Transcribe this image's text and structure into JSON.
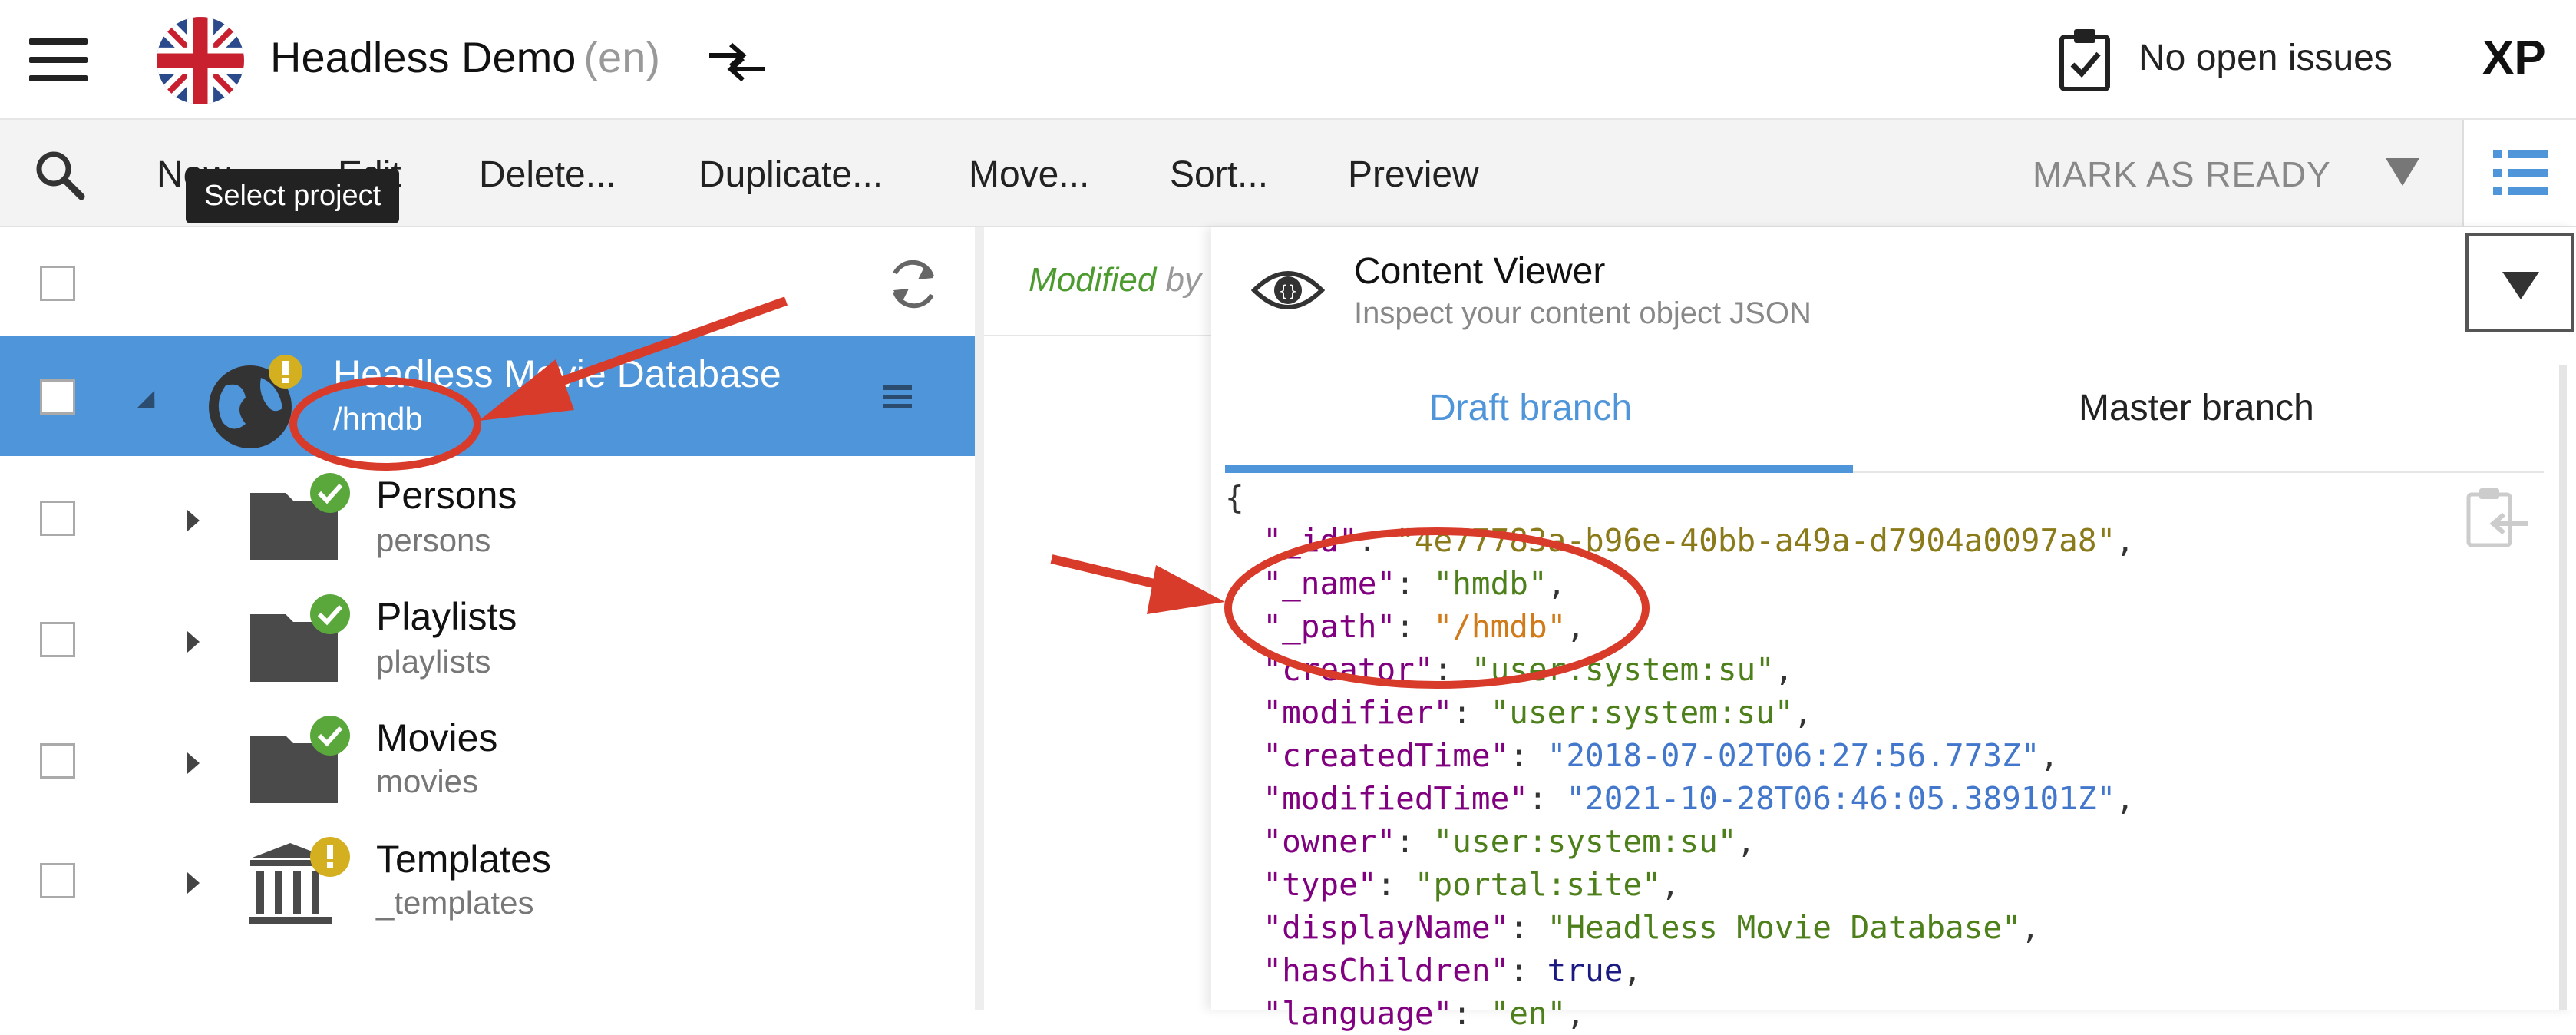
{
  "header": {
    "project_name": "Headless Demo",
    "project_lang": "(en)",
    "issues_label": "No open issues",
    "app_badge": "XP"
  },
  "toolbar": {
    "new_label": "New...",
    "edit_label": "Edit",
    "delete_label": "Delete...",
    "duplicate_label": "Duplicate...",
    "move_label": "Move...",
    "sort_label": "Sort...",
    "preview_label": "Preview",
    "mark_ready_label": "MARK AS READY",
    "tooltip": "Select project"
  },
  "tree": {
    "items": [
      {
        "name": "Headless Movie Database",
        "path": "/hmdb",
        "status": "warning"
      },
      {
        "name": "Persons",
        "path": "persons",
        "status": "ok"
      },
      {
        "name": "Playlists",
        "path": "playlists",
        "status": "ok"
      },
      {
        "name": "Movies",
        "path": "movies",
        "status": "ok"
      },
      {
        "name": "Templates",
        "path": "_templates",
        "status": "warning"
      }
    ]
  },
  "middle": {
    "modified_label": "Modified",
    "by_label": "by"
  },
  "panel": {
    "title": "Content Viewer",
    "subtitle": "Inspect your content object JSON",
    "tabs": [
      "Draft branch",
      "Master branch"
    ],
    "json_lines": [
      {
        "key": "_id",
        "val": "\"4e77783a-b96e-40bb-a49a-d7904a0097a8\"",
        "cls": "s-olive",
        "trail": ","
      },
      {
        "key": "_name",
        "val": "\"hmdb\"",
        "cls": "s-green",
        "trail": ","
      },
      {
        "key": "_path",
        "val": "\"/hmdb\"",
        "cls": "s-orange",
        "trail": ","
      },
      {
        "key": "creator",
        "val": "\"user:system:su\"",
        "cls": "s-green",
        "trail": ","
      },
      {
        "key": "modifier",
        "val": "\"user:system:su\"",
        "cls": "s-green",
        "trail": ","
      },
      {
        "key": "createdTime",
        "val": "\"2018-07-02T06:27:56.773Z\"",
        "cls": "s-blue",
        "trail": ","
      },
      {
        "key": "modifiedTime",
        "val": "\"2021-10-28T06:46:05.389101Z\"",
        "cls": "s-blue",
        "trail": ","
      },
      {
        "key": "owner",
        "val": "\"user:system:su\"",
        "cls": "s-green",
        "trail": ","
      },
      {
        "key": "type",
        "val": "\"portal:site\"",
        "cls": "s-green",
        "trail": ","
      },
      {
        "key": "displayName",
        "val": "\"Headless Movie Database\"",
        "cls": "s-green",
        "trail": ","
      },
      {
        "key": "hasChildren",
        "val": "true",
        "cls": "b",
        "trail": ","
      },
      {
        "key": "language",
        "val": "\"en\"",
        "cls": "s-green",
        "trail": ","
      }
    ],
    "json_open": "{"
  },
  "colors": {
    "accent": "#4f95d9",
    "annotation": "#d93b2b",
    "ok_badge": "#5aa83b",
    "warn_badge": "#d4b020"
  }
}
